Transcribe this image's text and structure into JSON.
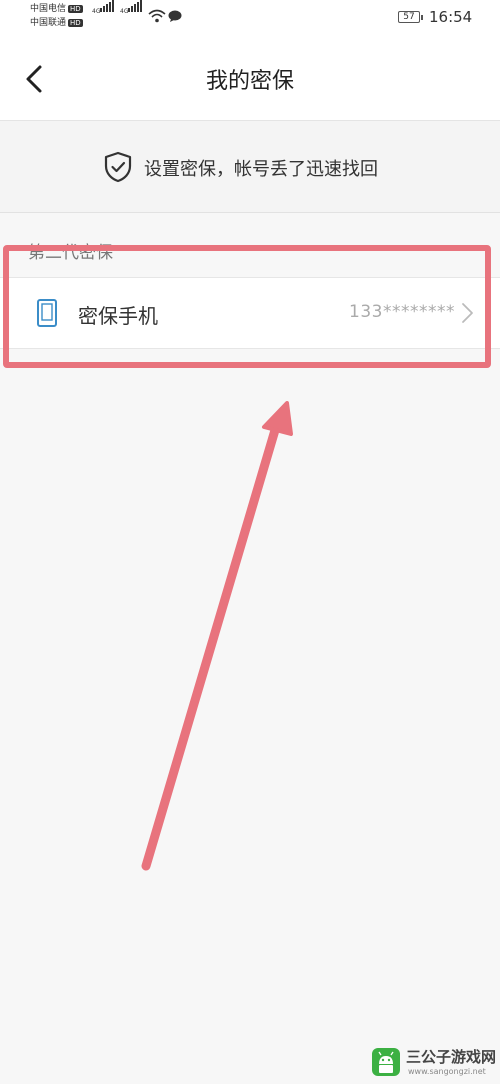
{
  "status_bar": {
    "carrier_1": "中国电信",
    "carrier_2": "中国联通",
    "hd_badge": "HD",
    "network_1": "4G",
    "network_2": "4G",
    "battery": "57",
    "time": "16:54"
  },
  "header": {
    "title": "我的密保",
    "back_icon": "chevron-left-icon"
  },
  "banner": {
    "icon": "shield-check-icon",
    "text": "设置密保，帐号丢了迅速找回"
  },
  "section": {
    "label": "第二代密保"
  },
  "rows": [
    {
      "icon": "phone-icon",
      "label": "密保手机",
      "value": "133********",
      "chevron": "chevron-right-icon"
    }
  ],
  "annotation": {
    "color": "#e8737d"
  },
  "watermark": {
    "name": "三公子游戏网",
    "url": "www.sangongzi.net",
    "accent": "#3cb043"
  }
}
